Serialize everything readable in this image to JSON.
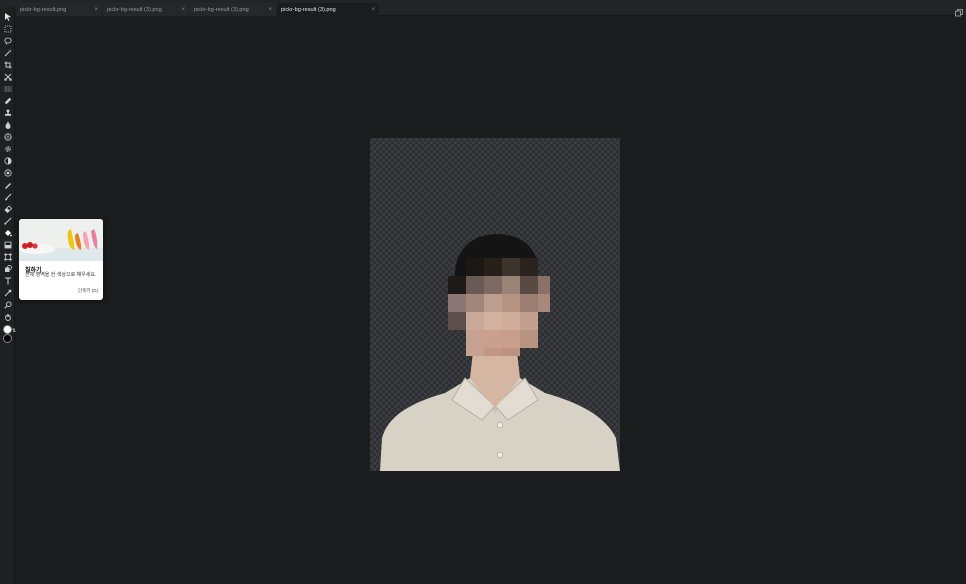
{
  "tabs": [
    {
      "label": "pickr-bg-result.png",
      "close": "×",
      "active": false
    },
    {
      "label": "pickr-bg-result (3).png",
      "close": "×",
      "active": false
    },
    {
      "label": "pickr-bg-result (3).png",
      "close": "×",
      "active": false
    },
    {
      "label": "pickr-bg-result (3).png",
      "close": "×",
      "active": true
    }
  ],
  "window_icon": "window-restore-icon",
  "toolbar": {
    "tools": [
      "move-icon",
      "marquee-icon",
      "lasso-icon",
      "magic-wand-icon",
      "crop-icon",
      "slice-icon",
      "pattern-icon",
      "healing-brush-icon",
      "clone-stamp-icon",
      "drop-icon",
      "sphere-icon",
      "gear-icon",
      "contrast-icon",
      "target-icon",
      "pen-icon",
      "brush-icon",
      "eraser-icon",
      "gradient-line-icon",
      "paint-bucket-icon",
      "layer-fill-icon",
      "transform-icon",
      "shape-icon",
      "type-icon",
      "eyedropper-icon",
      "zoom-icon",
      "hand-icon"
    ],
    "foreground_color": "#ffffff",
    "background_color": "#000000"
  },
  "tooltip": {
    "title": "칠하기",
    "description": "전체 영역을 한 색상으로 채우세요.",
    "shortcut": "단축키 (G)"
  },
  "colors": {
    "app_bg": "#1b1c1e",
    "tabbar_bg": "#232427",
    "shirt": "#d9d2c8",
    "hair": "#111111"
  }
}
